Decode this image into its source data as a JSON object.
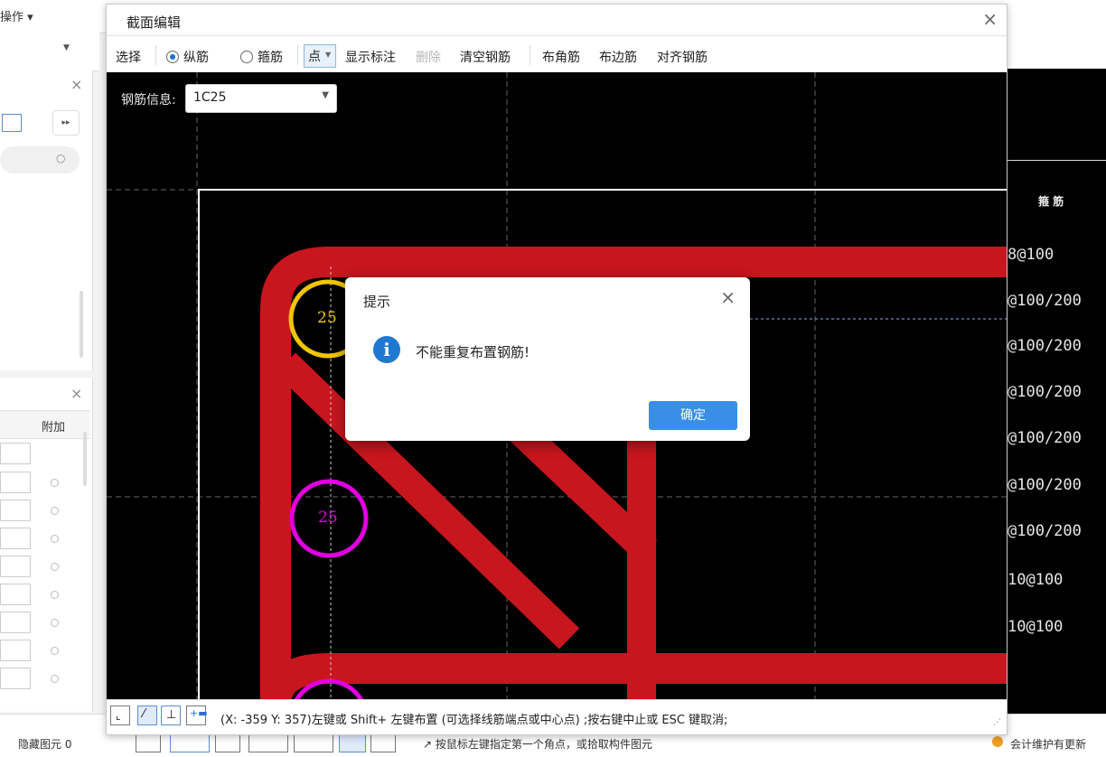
{
  "background": {
    "menu_label": "操作 ▾",
    "panel2_header": "附加",
    "cad_header": "箍 筋",
    "cad_rows": [
      "8@100",
      "@100/200",
      "@100/200",
      "@100/200",
      "@100/200",
      "@100/200",
      "@100/200",
      "10@100",
      "10@100"
    ],
    "bottom_left": "隐藏图元 0",
    "bottom_middle": "↗ 按鼠标左键指定第一个角点，或拾取构件图元",
    "bottom_right": "会计维护有更新"
  },
  "dialog": {
    "title": "截面编辑",
    "close": "×"
  },
  "toolbar": {
    "select": "选择",
    "longitudinal": "纵筋",
    "stirrup": "箍筋",
    "point": "点",
    "show_label": "显示标注",
    "delete": "删除",
    "clear_rebar": "清空钢筋",
    "corner_rebar": "布角筋",
    "edge_rebar": "布边筋",
    "align_rebar": "对齐钢筋",
    "selected_mode": "纵筋"
  },
  "canvas": {
    "info_label": "钢筋信息:",
    "rebar_value": "1C25",
    "rebar_labels": [
      "25",
      "25"
    ],
    "colors": {
      "section_red": "#c8161e",
      "selected_ring": "#f2c500",
      "rebar_ring": "#e000e0",
      "border": "#ffffff"
    }
  },
  "statusbar": {
    "text": "(X: -359 Y: 357)左键或 Shift+ 左键布置 (可选择线筋端点或中心点) ;按右键中止或 ESC 键取消;"
  },
  "message": {
    "title": "提示",
    "close": "×",
    "icon": "i",
    "text": "不能重复布置钢筋!",
    "ok": "确定"
  }
}
